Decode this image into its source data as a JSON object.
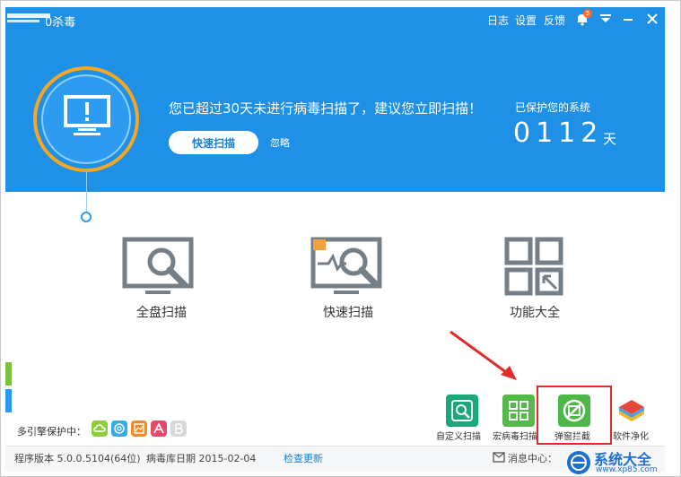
{
  "app": {
    "title": "0杀毒"
  },
  "header": {
    "menu": [
      "日志",
      "设置",
      "反馈"
    ],
    "notification_badge": "5"
  },
  "hero": {
    "headline": "您已超过30天未进行病毒扫描了，建议您立即扫描！",
    "quick_scan_button": "快速扫描",
    "ignore_link": "忽略",
    "protected_label": "已保护您的系统",
    "protected_days": "0112",
    "days_unit": "天"
  },
  "main_actions": [
    {
      "label": "全盘扫描",
      "icon": "monitor-magnifier-icon"
    },
    {
      "label": "快速扫描",
      "icon": "monitor-quick-scan-icon"
    },
    {
      "label": "功能大全",
      "icon": "grid-apps-icon"
    }
  ],
  "engines": {
    "label": "多引擎保护中：",
    "items": [
      {
        "name": "cloud-engine-icon",
        "color": "#8ccf3a"
      },
      {
        "name": "swirl-engine-icon",
        "color": "#3aa9e8"
      },
      {
        "name": "chart-engine-icon",
        "color": "#f08a2a"
      },
      {
        "name": "avira-engine-icon",
        "color": "#e64a6a"
      },
      {
        "name": "b-engine-icon",
        "color": "#cfcfcf"
      }
    ]
  },
  "tools": [
    {
      "label": "自定义扫描",
      "icon": "custom-scan-icon",
      "color": "#1aa87a"
    },
    {
      "label": "宏病毒扫描",
      "icon": "macro-scan-icon",
      "color": "#54b948"
    },
    {
      "label": "弹窗拦截",
      "icon": "popup-block-icon",
      "color": "#4cb848"
    },
    {
      "label": "软件净化",
      "icon": "software-clean-icon",
      "color": "#7a5cc4"
    }
  ],
  "footer": {
    "version": "程序版本 5.0.0.5104(64位)",
    "db_date": "病毒库日期  2015-02-04",
    "check_update": "检查更新",
    "message_center": "消息中心："
  },
  "watermark": {
    "text": "系统大全",
    "url": "www.xp85.com"
  },
  "colors": {
    "brand_blue": "#1e90e6",
    "ring_orange": "#f5a623",
    "highlight_red": "#e02b2b"
  }
}
